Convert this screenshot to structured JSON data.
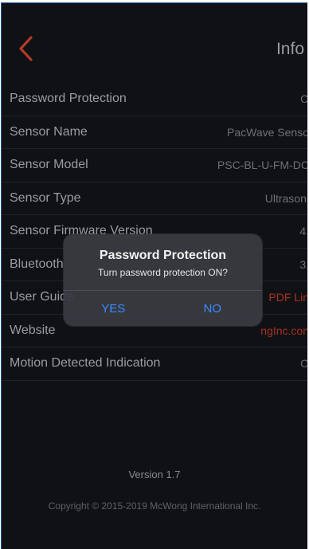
{
  "nav": {
    "title": "Info",
    "back_icon": "chevron-left-icon",
    "back_color": "#b33a28"
  },
  "rows": [
    {
      "label": "Password Protection",
      "value": "O",
      "link": false
    },
    {
      "label": "Sensor Name",
      "value": "PacWave Senso",
      "link": false
    },
    {
      "label": "Sensor Model",
      "value": "PSC-BL-U-FM-DC",
      "link": false
    },
    {
      "label": "Sensor Type",
      "value": "Ultrasoni",
      "link": false
    },
    {
      "label": "Sensor Firmware Version",
      "value": "4.",
      "link": false
    },
    {
      "label": "Bluetooth",
      "value": "3.",
      "link": false
    },
    {
      "label": "User Guide",
      "value": "PDF Lin",
      "link": true
    },
    {
      "label": "Website",
      "value": "ngInc.con",
      "link": true
    },
    {
      "label": "Motion Detected Indication",
      "value": "O",
      "link": false
    }
  ],
  "footer": {
    "version": "Version 1.7",
    "copyright": "Copyright © 2015-2019 McWong International Inc."
  },
  "dialog": {
    "title": "Password Protection",
    "message": "Turn password protection ON?",
    "yes_label": "YES",
    "no_label": "NO"
  },
  "colors": {
    "background": "#0f1115",
    "link": "#a8321f",
    "dialog_button": "#3d8bff"
  }
}
